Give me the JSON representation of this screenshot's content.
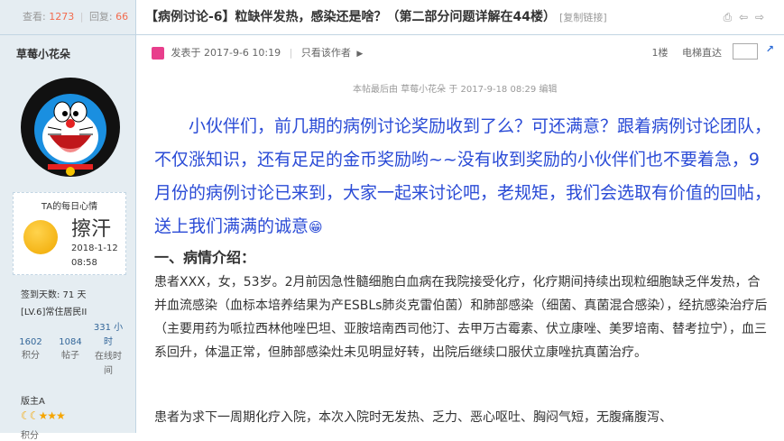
{
  "stats": {
    "views_label": "查看:",
    "views": "1273",
    "replies_label": "回复:",
    "replies": "66"
  },
  "thread": {
    "title": "【病例讨论-6】粒缺伴发热，感染还是啥？（第二部分问题详解在44楼）",
    "copy_link": "[复制链接]"
  },
  "author": {
    "name": "草莓小花朵",
    "mood_title": "TA的每日心情",
    "mood_text": "擦汗",
    "mood_date": "2018-1-12",
    "mood_time": "08:58",
    "sign_days": "签到天数: 71 天",
    "level": "[LV.6]常住居民II",
    "points": "1602",
    "points_label": "积分",
    "posts": "1084",
    "posts_label": "帖子",
    "online": "331 小时",
    "online_label": "在线时间",
    "rank": "版主A",
    "last_partial": "积分"
  },
  "post": {
    "posted": "发表于 2017-9-6 10:19",
    "only_author": "只看该作者",
    "floor": "1楼",
    "elevator": "电梯直达",
    "edit_note": "本帖最后由 草莓小花朵 于 2017-9-18 08:29 编辑",
    "lead": "小伙伴们，前几期的病例讨论奖励收到了么？可还满意？跟着病例讨论团队，不仅涨知识，还有足足的金币奖励哟~~没有收到奖励的小伙伴们也不要着急，9月份的病例讨论已来到，大家一起来讨论吧，老规矩，我们会选取有价值的回帖，送上我们满满的诚意",
    "lead_emoji": "😁",
    "section1": "一、病情介绍：",
    "para1": "患者XXX，女，53岁。2月前因急性髓细胞白血病在我院接受化疗，化疗期间持续出现粒细胞缺乏伴发热，合并血流感染（血标本培养结果为产ESBLs肺炎克雷伯菌）和肺部感染（细菌、真菌混合感染），经抗感染治疗后（主要用药为哌拉西林他唑巴坦、亚胺培南西司他汀、去甲万古霉素、伏立康唑、美罗培南、替考拉宁），血三系回升，体温正常，但肺部感染灶未见明显好转，出院后继续口服伏立康唑抗真菌治疗。",
    "para2": "患者为求下一周期化疗入院，本次入院时无发热、乏力、恶心呕吐、胸闷气短，无腹痛腹泻、"
  }
}
